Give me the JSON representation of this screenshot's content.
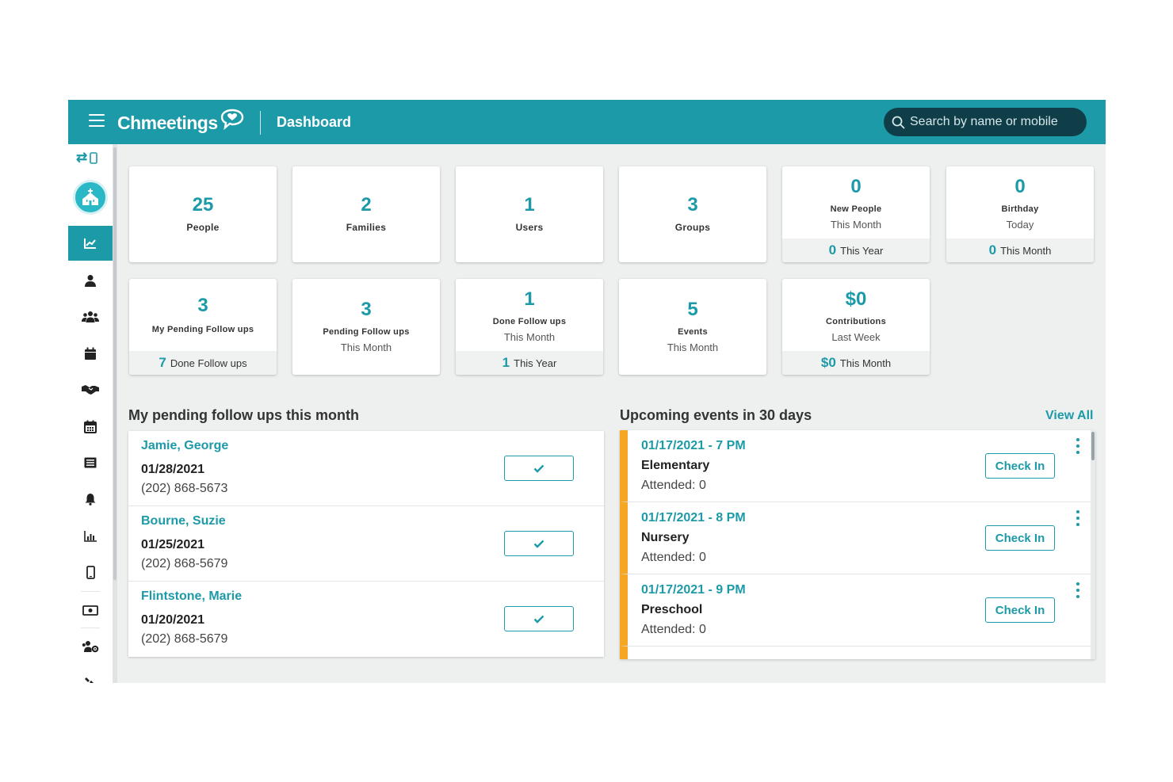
{
  "header": {
    "logo_text": "Chmeetings",
    "page_title": "Dashboard",
    "search_placeholder": "Search by name or mobile"
  },
  "sidebar": {
    "swap_icon": "swap-device-icon",
    "org_icon": "church-icon",
    "active_item": "dashboard",
    "items": [
      {
        "name": "dashboard",
        "icon": "chart-line-icon"
      },
      {
        "name": "people",
        "icon": "person-icon"
      },
      {
        "name": "groups",
        "icon": "users-icon"
      },
      {
        "name": "events",
        "icon": "calendar-icon"
      },
      {
        "name": "follow-ups",
        "icon": "handshake-icon"
      },
      {
        "name": "calendar",
        "icon": "calendar-grid-icon"
      },
      {
        "name": "forms",
        "icon": "list-icon"
      },
      {
        "name": "notifications",
        "icon": "bell-icon"
      },
      {
        "name": "reports",
        "icon": "bar-chart-icon"
      },
      {
        "name": "mobile",
        "icon": "mobile-icon"
      },
      {
        "name": "contributions",
        "icon": "money-icon"
      },
      {
        "name": "volunteers",
        "icon": "users-gear-icon"
      },
      {
        "name": "tools",
        "icon": "tools-icon"
      }
    ]
  },
  "stats": {
    "people": {
      "value": "25",
      "label": "People"
    },
    "families": {
      "value": "2",
      "label": "Families"
    },
    "users": {
      "value": "1",
      "label": "Users"
    },
    "groups": {
      "value": "3",
      "label": "Groups"
    },
    "new_people": {
      "value": "0",
      "label": "New People",
      "sub": "This Month",
      "foot_value": "0",
      "foot_label": "This Year"
    },
    "birthday": {
      "value": "0",
      "label": "Birthday",
      "sub": "Today",
      "foot_value": "0",
      "foot_label": "This Month"
    },
    "my_pending": {
      "value": "3",
      "label": "My Pending Follow ups",
      "foot_value": "7",
      "foot_label": "Done Follow ups"
    },
    "pending": {
      "value": "3",
      "label": "Pending Follow ups",
      "sub": "This Month"
    },
    "done": {
      "value": "1",
      "label": "Done Follow ups",
      "sub": "This Month",
      "foot_value": "1",
      "foot_label": "This Year"
    },
    "events": {
      "value": "5",
      "label": "Events",
      "sub": "This Month"
    },
    "contributions": {
      "value": "$0",
      "label": "Contributions",
      "sub": "Last Week",
      "foot_value": "$0",
      "foot_label": "This Month"
    }
  },
  "followups": {
    "title": "My pending follow ups this month",
    "items": [
      {
        "name": "Jamie, George",
        "date": "01/28/2021",
        "phone": "(202) 868-5673"
      },
      {
        "name": "Bourne, Suzie",
        "date": "01/25/2021",
        "phone": "(202) 868-5679"
      },
      {
        "name": "Flintstone, Marie",
        "date": "01/20/2021",
        "phone": "(202) 868-5679"
      }
    ]
  },
  "events": {
    "title": "Upcoming events in 30 days",
    "view_all": "View All",
    "check_in_label": "Check In",
    "accent": "#f5a623",
    "items": [
      {
        "date": "01/17/2021 - 7 PM",
        "name": "Elementary",
        "attended": "Attended: 0"
      },
      {
        "date": "01/17/2021 - 8 PM",
        "name": "Nursery",
        "attended": "Attended: 0"
      },
      {
        "date": "01/17/2021 - 9 PM",
        "name": "Preschool",
        "attended": "Attended: 0"
      }
    ]
  },
  "colors": {
    "brand": "#1d9aa8",
    "search_bg": "#0f3e48",
    "background": "#eef0f0"
  }
}
